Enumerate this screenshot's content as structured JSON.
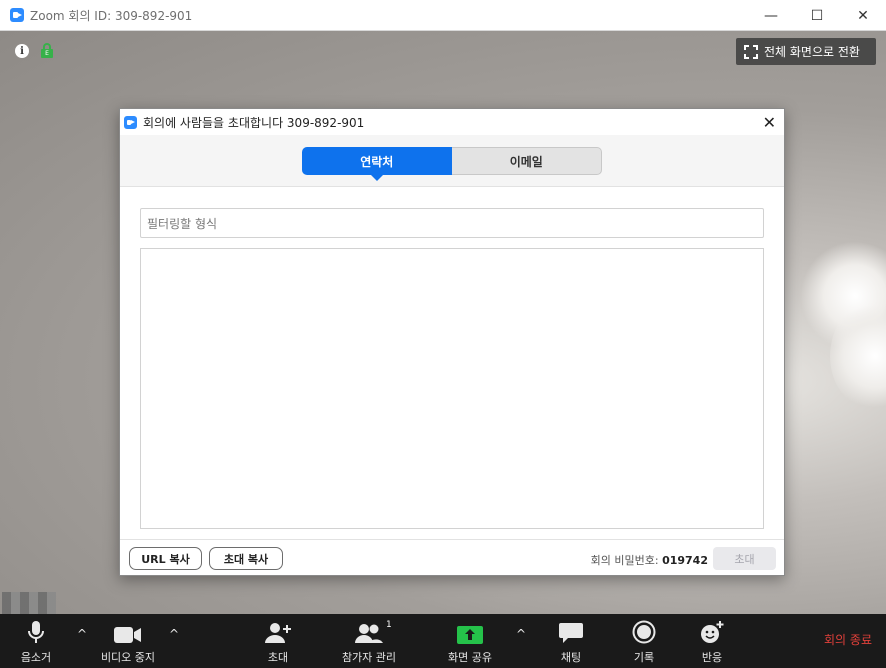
{
  "window": {
    "title": "Zoom 회의 ID: 309-892-901",
    "minimize_glyph": "—",
    "maximize_glyph": "☐",
    "close_glyph": "✕"
  },
  "video": {
    "fullscreen_label": "전체 화면으로 전환",
    "info_glyph": "i",
    "lock_glyph": "E"
  },
  "dialog": {
    "title": "회의에 사람들을 초대합니다 309-892-901",
    "close_glyph": "✕",
    "tabs": [
      {
        "label": "연락처",
        "active": true
      },
      {
        "label": "이메일",
        "active": false
      }
    ],
    "filter_placeholder": "필터링할 형식",
    "footer": {
      "copy_url_label": "URL 복사",
      "copy_invite_label": "초대 복사",
      "password_label": "회의 비밀번호:",
      "password_value": "019742",
      "invite_label": "초대"
    }
  },
  "toolbar": {
    "mute_label": "음소거",
    "video_label": "비디오 중지",
    "invite_label": "초대",
    "participants_label": "참가자 관리",
    "participants_count": "1",
    "share_label": "화면 공유",
    "chat_label": "채팅",
    "record_label": "기록",
    "reactions_label": "반응",
    "end_label": "회의 종료",
    "caret_glyph": "^"
  },
  "colors": {
    "accent": "#0e72ed",
    "share_green": "#25c24a",
    "end_red": "#e0403a",
    "toolbar_bg": "#1a1a1a"
  }
}
